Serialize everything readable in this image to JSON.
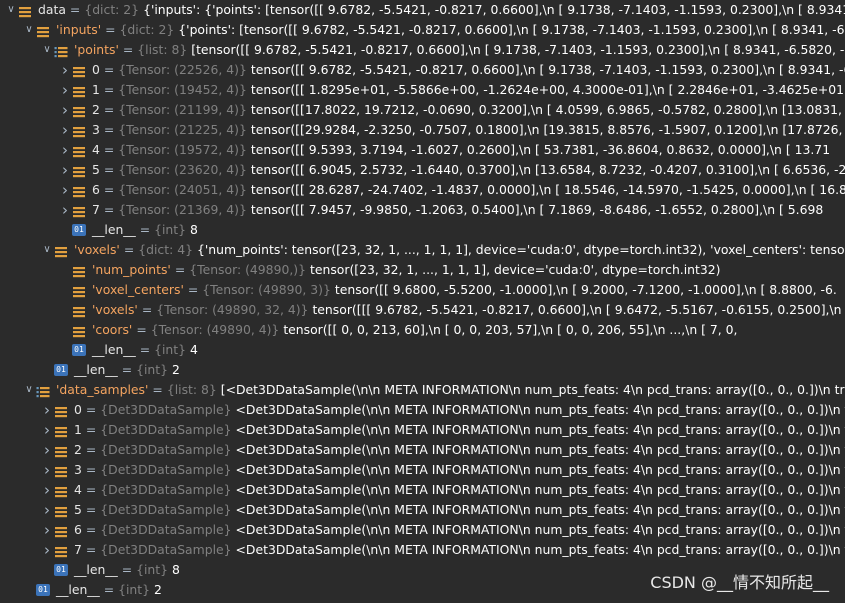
{
  "rows": [
    {
      "indent": 0,
      "arrow": "down",
      "icon": "leaf",
      "name": "data",
      "name_style": "plain",
      "type": "{dict: 2}",
      "value": "{'inputs': {'points': [tensor([[ 9.6782, -5.5421, -0.8217,  0.6600],\\n          [ 9.1738, -7.1403, -1.1593,  0.2300],\\n          [ 8.9341, -6."
    },
    {
      "indent": 1,
      "arrow": "down",
      "icon": "leaf",
      "name": "'inputs'",
      "name_style": "str",
      "type": "{dict: 2}",
      "value": "{'points': [tensor([[ 9.6782, -5.5421, -0.8217,  0.6600],\\n          [ 9.1738, -7.1403, -1.1593,  0.2300],\\n          [ 8.9341, -6.582"
    },
    {
      "indent": 2,
      "arrow": "down",
      "icon": "list",
      "name": "'points'",
      "name_style": "str",
      "type": "{list: 8}",
      "value": "[tensor([[ 9.6782, -5.5421, -0.8217,  0.6600],\\n          [ 9.1738, -7.1403, -1.1593,  0.2300],\\n          [ 8.9341, -6.5820, -1.1620, 0."
    },
    {
      "indent": 3,
      "arrow": "right",
      "icon": "leaf",
      "name": "0",
      "name_style": "plain",
      "type": "{Tensor: (22526, 4)}",
      "value": "tensor([[ 9.6782, -5.5421, -0.8217,  0.6600],\\n          [ 9.1738, -7.1403, -1.1593,  0.2300],\\n          [ 8.9341, -6.5"
    },
    {
      "indent": 3,
      "arrow": "right",
      "icon": "leaf",
      "name": "1",
      "name_style": "plain",
      "type": "{Tensor: (19452, 4)}",
      "value": "tensor([[ 1.8295e+01, -5.5866e+00, -1.2624e+00,  4.3000e-01],\\n          [ 2.2846e+01, -3.4625e+01, -8.7456"
    },
    {
      "indent": 3,
      "arrow": "right",
      "icon": "leaf",
      "name": "2",
      "name_style": "plain",
      "type": "{Tensor: (21199, 4)}",
      "value": "tensor([[17.8022, 19.7212, -0.0690,  0.3200],\\n          [ 4.0599,  6.9865, -0.5782,  0.2800],\\n          [13.0831,  4."
    },
    {
      "indent": 3,
      "arrow": "right",
      "icon": "leaf",
      "name": "3",
      "name_style": "plain",
      "type": "{Tensor: (21225, 4)}",
      "value": "tensor([[29.9284, -2.3250, -0.7507,  0.1800],\\n          [19.3815,  8.8576, -1.5907,  0.1200],\\n          [17.8726, 14."
    },
    {
      "indent": 3,
      "arrow": "right",
      "icon": "leaf",
      "name": "4",
      "name_style": "plain",
      "type": "{Tensor: (19572, 4)}",
      "value": "tensor([[  9.5393,   3.7194,  -1.6027,   0.2600],\\n          [ 53.7381, -36.8604,   0.8632,   0.0000],\\n          [ 13.71"
    },
    {
      "indent": 3,
      "arrow": "right",
      "icon": "leaf",
      "name": "5",
      "name_style": "plain",
      "type": "{Tensor: (23620, 4)}",
      "value": "tensor([[ 6.9045,  2.5732, -1.6440,  0.3700],\\n          [13.6584,  8.7232, -0.4207,  0.3100],\\n          [ 6.6536, -2.9"
    },
    {
      "indent": 3,
      "arrow": "right",
      "icon": "leaf",
      "name": "6",
      "name_style": "plain",
      "type": "{Tensor: (24051, 4)}",
      "value": "tensor([[ 28.6287, -24.7402,  -1.4837,   0.0000],\\n          [ 18.5546, -14.5970,  -1.5425,   0.0000],\\n          [ 16.8"
    },
    {
      "indent": 3,
      "arrow": "right",
      "icon": "leaf",
      "name": "7",
      "name_style": "plain",
      "type": "{Tensor: (21369, 4)}",
      "value": "tensor([[ 7.9457, -9.9850, -1.2063,  0.5400],\\n          [ 7.1869, -8.6486, -1.6552,  0.2800],\\n          [ 5.698"
    },
    {
      "indent": 3,
      "arrow": "none",
      "icon": "int",
      "name": "__len__",
      "name_style": "plain",
      "type": "{int}",
      "value": "8"
    },
    {
      "indent": 2,
      "arrow": "down",
      "icon": "leaf",
      "name": "'voxels'",
      "name_style": "str",
      "type": "{dict: 4}",
      "value": "{'num_points': tensor([23, 32,  1,  ...,  1,  1,  1], device='cuda:0', dtype=torch.int32), 'voxel_centers': tensor([[  9.6800"
    },
    {
      "indent": 3,
      "arrow": "none",
      "icon": "leaf",
      "name": "'num_points'",
      "name_style": "str",
      "type": "{Tensor: (49890,)}",
      "value": "tensor([23, 32,  1,  ...,  1,  1,  1], device='cuda:0', dtype=torch.int32)"
    },
    {
      "indent": 3,
      "arrow": "none",
      "icon": "leaf",
      "name": "'voxel_centers'",
      "name_style": "str",
      "type": "{Tensor: (49890, 3)}",
      "value": "tensor([[  9.6800,  -5.5200,  -1.0000],\\n          [  9.2000,  -7.1200,  -1.0000],\\n          [  8.8800,  -6."
    },
    {
      "indent": 3,
      "arrow": "none",
      "icon": "leaf",
      "name": "'voxels'",
      "name_style": "str",
      "type": "{Tensor: (49890, 32, 4)}",
      "value": "tensor([[[ 9.6782, -5.5421, -0.8217,  0.6600],\\n          [ 9.6472, -5.5167, -0.6155,  0.2500],\\n          ["
    },
    {
      "indent": 3,
      "arrow": "none",
      "icon": "leaf",
      "name": "'coors'",
      "name_style": "str",
      "type": "{Tensor: (49890, 4)}",
      "value": "tensor([[  0,   0, 213,  60],\\n          [  0,   0, 203,  57],\\n          [  0,   0, 206,  55],\\n          ...,\\n          [  7,   0,"
    },
    {
      "indent": 3,
      "arrow": "none",
      "icon": "int",
      "name": "__len__",
      "name_style": "plain",
      "type": "{int}",
      "value": "4"
    },
    {
      "indent": 2,
      "arrow": "none",
      "icon": "int",
      "name": "__len__",
      "name_style": "plain",
      "type": "{int}",
      "value": "2"
    },
    {
      "indent": 1,
      "arrow": "down",
      "icon": "list",
      "name": "'data_samples'",
      "name_style": "str",
      "type": "{list: 8}",
      "value": "[<Det3DDataSample(\\n\\n    META INFORMATION\\n    num_pts_feats: 4\\n    pcd_trans: array([0., 0., 0.])\\n    trans"
    },
    {
      "indent": 2,
      "arrow": "right",
      "icon": "leaf",
      "name": "0",
      "name_style": "plain",
      "type": "{Det3DDataSample}",
      "value": "<Det3DDataSample(\\n\\n    META INFORMATION\\n    num_pts_feats: 4\\n    pcd_trans: array([0., 0., 0.])\\n    tr"
    },
    {
      "indent": 2,
      "arrow": "right",
      "icon": "leaf",
      "name": "1",
      "name_style": "plain",
      "type": "{Det3DDataSample}",
      "value": "<Det3DDataSample(\\n\\n    META INFORMATION\\n    num_pts_feats: 4\\n    pcd_trans: array([0., 0., 0.])\\n    tr"
    },
    {
      "indent": 2,
      "arrow": "right",
      "icon": "leaf",
      "name": "2",
      "name_style": "plain",
      "type": "{Det3DDataSample}",
      "value": "<Det3DDataSample(\\n\\n    META INFORMATION\\n    num_pts_feats: 4\\n    pcd_trans: array([0., 0., 0.])\\n    tr"
    },
    {
      "indent": 2,
      "arrow": "right",
      "icon": "leaf",
      "name": "3",
      "name_style": "plain",
      "type": "{Det3DDataSample}",
      "value": "<Det3DDataSample(\\n\\n    META INFORMATION\\n    num_pts_feats: 4\\n    pcd_trans: array([0., 0., 0.])\\n    tr"
    },
    {
      "indent": 2,
      "arrow": "right",
      "icon": "leaf",
      "name": "4",
      "name_style": "plain",
      "type": "{Det3DDataSample}",
      "value": "<Det3DDataSample(\\n\\n    META INFORMATION\\n    num_pts_feats: 4\\n    pcd_trans: array([0., 0., 0.])\\n    tr"
    },
    {
      "indent": 2,
      "arrow": "right",
      "icon": "leaf",
      "name": "5",
      "name_style": "plain",
      "type": "{Det3DDataSample}",
      "value": "<Det3DDataSample(\\n\\n    META INFORMATION\\n    num_pts_feats: 4\\n    pcd_trans: array([0., 0., 0.])\\n    tr"
    },
    {
      "indent": 2,
      "arrow": "right",
      "icon": "leaf",
      "name": "6",
      "name_style": "plain",
      "type": "{Det3DDataSample}",
      "value": "<Det3DDataSample(\\n\\n    META INFORMATION\\n    num_pts_feats: 4\\n    pcd_trans: array([0., 0., 0.])\\n    tr"
    },
    {
      "indent": 2,
      "arrow": "right",
      "icon": "leaf",
      "name": "7",
      "name_style": "plain",
      "type": "{Det3DDataSample}",
      "value": "<Det3DDataSample(\\n\\n    META INFORMATION\\n    num_pts_feats: 4\\n    pcd_trans: array([0., 0., 0.])\\n    tr"
    },
    {
      "indent": 2,
      "arrow": "none",
      "icon": "int",
      "name": "__len__",
      "name_style": "plain",
      "type": "{int}",
      "value": "8"
    },
    {
      "indent": 1,
      "arrow": "none",
      "icon": "int",
      "name": "__len__",
      "name_style": "plain",
      "type": "{int}",
      "value": "2"
    }
  ],
  "icon_labels": {
    "int": "01"
  },
  "colors": {
    "background": "#2b2b2b",
    "leaf_icon": "#e2a03f",
    "int_icon": "#3b73b9",
    "string_key": "#f4a460",
    "type_hint": "#808080"
  },
  "watermark": "CSDN @__情不知所起__"
}
